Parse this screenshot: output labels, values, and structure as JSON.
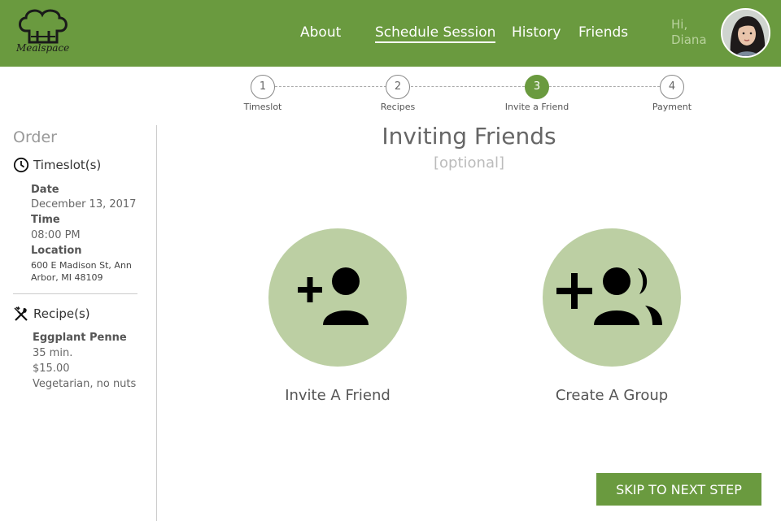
{
  "header": {
    "logo_text": "Mealspace",
    "nav": [
      {
        "label": "About"
      },
      {
        "label": "Schedule Session"
      },
      {
        "label": "History"
      },
      {
        "label": "Friends"
      }
    ],
    "greeting_hi": "Hi,",
    "greeting_name": "Diana",
    "brand_color": "#6a9a3f"
  },
  "stepper": {
    "steps": [
      {
        "number": "1",
        "label": "Timeslot"
      },
      {
        "number": "2",
        "label": "Recipes"
      },
      {
        "number": "3",
        "label": "Invite a Friend"
      },
      {
        "number": "4",
        "label": "Payment"
      }
    ],
    "active_step": 3
  },
  "sidebar": {
    "title": "Order",
    "timeslot": {
      "heading": "Timeslot(s)",
      "date_label": "Date",
      "date_value": "December 13, 2017",
      "time_label": "Time",
      "time_value": "08:00 PM",
      "location_label": "Location",
      "location_value": "600 E Madison St, Ann Arbor, MI 48109"
    },
    "recipes": {
      "heading": "Recipe(s)",
      "name": "Eggplant Penne",
      "duration": "35 min.",
      "price": "$15.00",
      "notes": "Vegetarian, no nuts"
    }
  },
  "main": {
    "title": "Inviting Friends",
    "subtitle": "[optional]",
    "options": [
      {
        "label": "Invite A Friend",
        "icon": "add-person-icon"
      },
      {
        "label": "Create A Group",
        "icon": "add-group-icon"
      }
    ],
    "skip_label": "SKIP TO NEXT STEP"
  }
}
